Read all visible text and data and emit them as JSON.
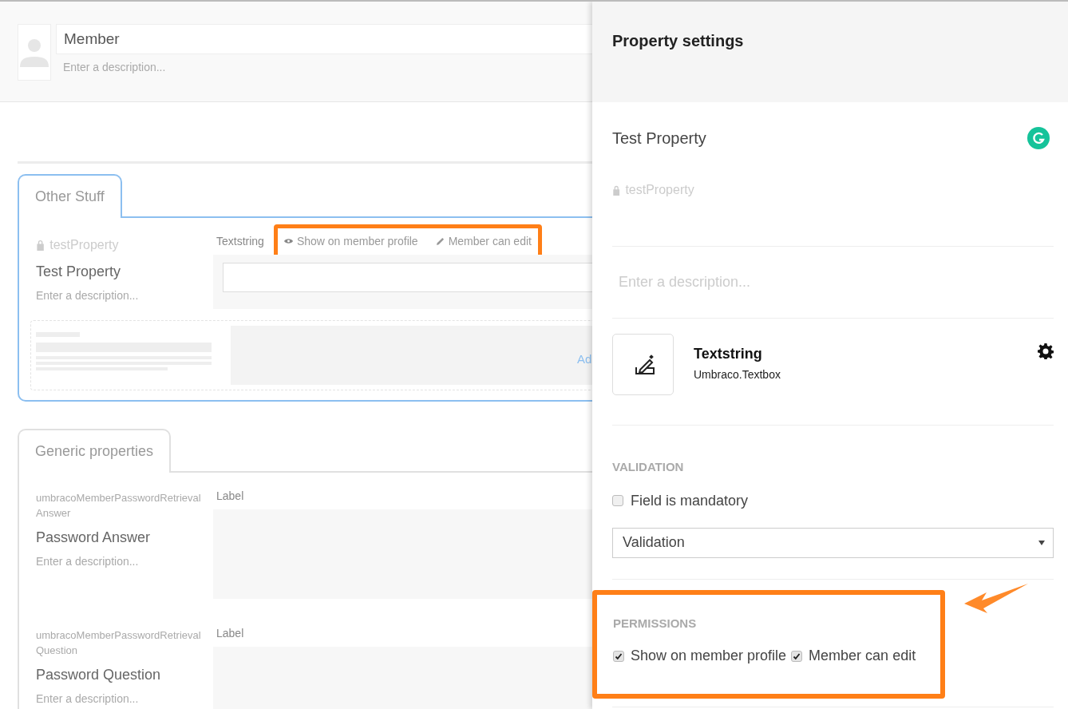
{
  "header": {
    "name": "Member",
    "description_placeholder": "Enter a description..."
  },
  "groups": [
    {
      "tab": "Other Stuff",
      "selected": true,
      "properties": [
        {
          "alias": "testProperty",
          "locked": true,
          "name": "Test Property",
          "description_placeholder": "Enter a description...",
          "editor": "Textstring",
          "highlighted": true,
          "has_input": true,
          "badges": [
            {
              "kind": "eye",
              "label": "Show on member profile"
            },
            {
              "kind": "pencil",
              "label": "Member can edit"
            }
          ]
        }
      ],
      "add_property": "Ad"
    },
    {
      "tab": "Generic properties",
      "selected": false,
      "properties": [
        {
          "alias": "umbracoMemberPasswordRetrievalAnswer",
          "locked": false,
          "name": "Password Answer",
          "description_placeholder": "Enter a description...",
          "editor": "Label",
          "has_input": false
        },
        {
          "alias": "umbracoMemberPasswordRetrievalQuestion",
          "locked": false,
          "name": "Password Question",
          "description_placeholder": "Enter a description...",
          "editor": "Label",
          "has_input": false
        }
      ]
    }
  ],
  "panel": {
    "title": "Property settings",
    "name": "Test Property",
    "alias": "testProperty",
    "alias_locked": true,
    "description_placeholder": "Enter a description...",
    "editor": {
      "name": "Textstring",
      "alias": "Umbraco.Textbox"
    },
    "validation": {
      "heading": "VALIDATION",
      "mandatory": {
        "label": "Field is mandatory",
        "checked": false
      },
      "select": "Validation"
    },
    "permissions": {
      "heading": "PERMISSIONS",
      "highlighted": true,
      "options": [
        {
          "label": "Show on member profile",
          "checked": true
        },
        {
          "label": "Member can edit",
          "checked": true
        }
      ]
    }
  }
}
